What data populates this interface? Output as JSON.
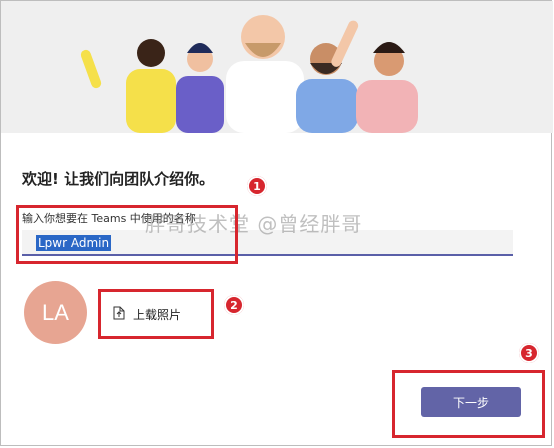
{
  "dialog": {
    "title": "欢迎! 让我们向团队介绍你。",
    "field_label": "输入你想要在 Teams 中使用的名称",
    "name_value": "Lpwr Admin",
    "avatar_initials": "LA",
    "upload_label": "上载照片",
    "next_label": "下一步"
  },
  "annotations": {
    "step1": "1",
    "step2": "2",
    "step3": "3"
  },
  "watermark": "胖哥技术堂 @曾经胖哥",
  "colors": {
    "accent": "#6264a7",
    "avatar_bg": "#e7a592",
    "annotation_red": "#d7262e"
  }
}
